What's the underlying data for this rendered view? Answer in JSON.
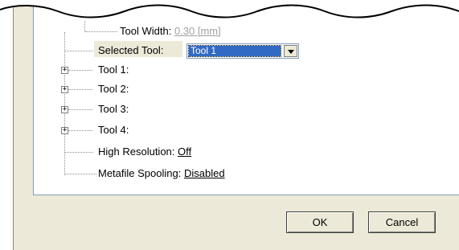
{
  "tree": {
    "tool_width_label": "Tool Width:",
    "tool_width_value": "0.30 [mm]",
    "selected_tool_label": "Selected Tool:",
    "selected_tool_value": "Tool 1",
    "tool1_label": "Tool 1:",
    "tool2_label": "Tool 2:",
    "tool3_label": "Tool 3:",
    "tool4_label": "Tool 4:",
    "high_res_label": "High Resolution:",
    "high_res_value": "Off",
    "metafile_label": "Metafile Spooling:",
    "metafile_value": "Disabled",
    "expander_glyph": "+"
  },
  "buttons": {
    "ok": "OK",
    "cancel": "Cancel"
  },
  "colors": {
    "selection": "#316ac5",
    "dialog_bg": "#ece9d8",
    "tree_border": "#7f9db9"
  }
}
